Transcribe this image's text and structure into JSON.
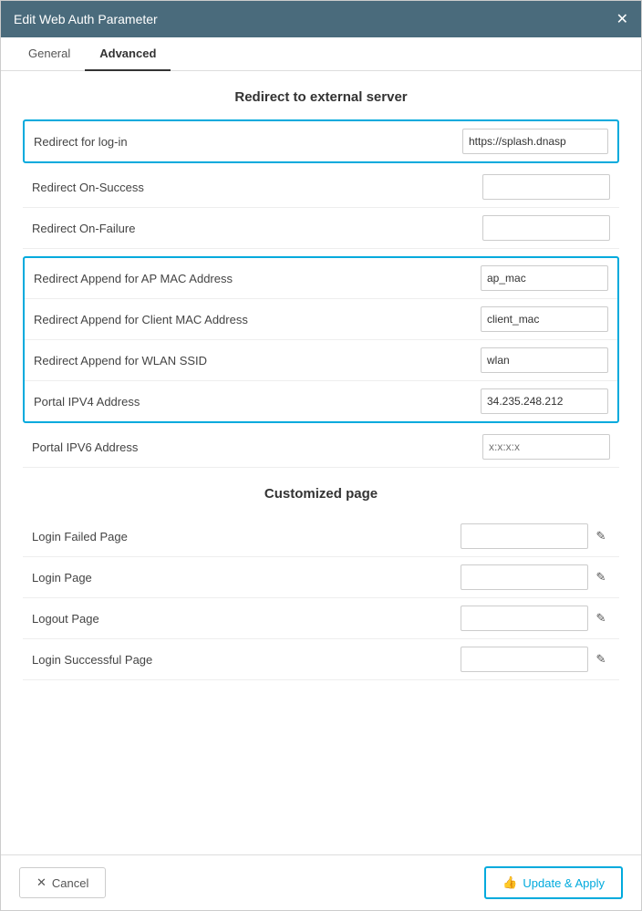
{
  "modal": {
    "title": "Edit Web Auth Parameter",
    "close_icon": "✕"
  },
  "tabs": [
    {
      "label": "General",
      "active": false
    },
    {
      "label": "Advanced",
      "active": true
    }
  ],
  "external_server": {
    "title": "Redirect to external server",
    "fields": [
      {
        "label": "Redirect for log-in",
        "value": "https://splash.dnasp",
        "placeholder": "",
        "group": "top",
        "has_edit": false
      },
      {
        "label": "Redirect On-Success",
        "value": "",
        "placeholder": "",
        "group": "none",
        "has_edit": false
      },
      {
        "label": "Redirect On-Failure",
        "value": "",
        "placeholder": "",
        "group": "none",
        "has_edit": false
      },
      {
        "label": "Redirect Append for AP MAC Address",
        "value": "ap_mac",
        "placeholder": "",
        "group": "middle",
        "has_edit": false
      },
      {
        "label": "Redirect Append for Client MAC Address",
        "value": "client_mac",
        "placeholder": "",
        "group": "middle",
        "has_edit": false
      },
      {
        "label": "Redirect Append for WLAN SSID",
        "value": "wlan",
        "placeholder": "",
        "group": "middle",
        "has_edit": false
      },
      {
        "label": "Portal IPV4 Address",
        "value": "34.235.248.212",
        "placeholder": "",
        "group": "middle",
        "has_edit": false
      },
      {
        "label": "Portal IPV6 Address",
        "value": "",
        "placeholder": "x:x:x:x",
        "group": "none",
        "has_edit": false
      }
    ]
  },
  "customized_page": {
    "title": "Customized page",
    "fields": [
      {
        "label": "Login Failed Page",
        "value": "",
        "placeholder": ""
      },
      {
        "label": "Login Page",
        "value": "",
        "placeholder": ""
      },
      {
        "label": "Logout Page",
        "value": "",
        "placeholder": ""
      },
      {
        "label": "Login Successful Page",
        "value": "",
        "placeholder": ""
      }
    ]
  },
  "footer": {
    "cancel_label": "Cancel",
    "cancel_icon": "✕",
    "update_label": "Update & Apply",
    "update_icon": "👍"
  }
}
